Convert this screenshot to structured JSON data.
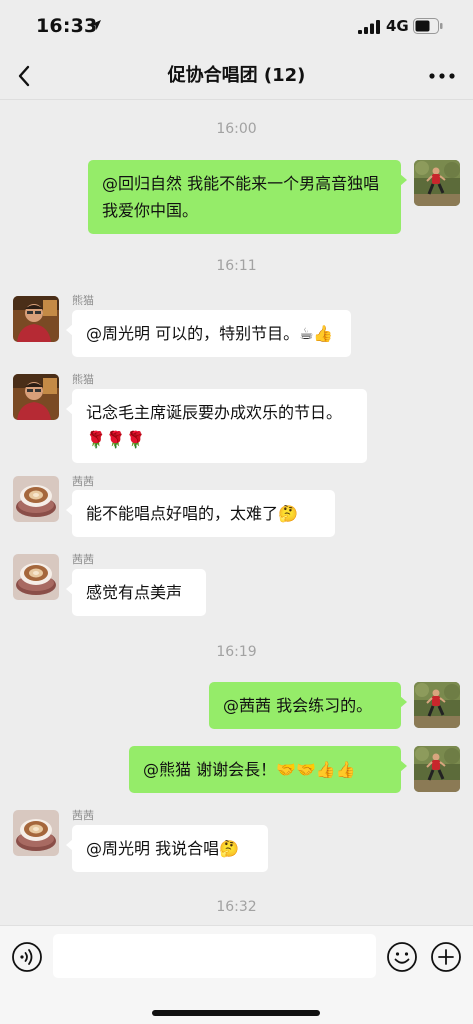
{
  "status_bar": {
    "time": "16:33",
    "network": "4G"
  },
  "header": {
    "title": "促协合唱团 (12)"
  },
  "chat": {
    "timestamps": [
      "16:00",
      "16:11",
      "16:19",
      "16:32"
    ],
    "messages": [
      {
        "side": "out",
        "text": "@回归自然 我能不能来一个男高音独唱  我爱你中国。"
      },
      {
        "side": "in",
        "sender": "熊猫",
        "text": "@周光明 可以的，特别节目。☕👍"
      },
      {
        "side": "in",
        "sender": "熊猫",
        "text": "记念毛主席诞辰要办成欢乐的节日。🌹🌹🌹"
      },
      {
        "side": "in",
        "sender": "茜茜",
        "text": "能不能唱点好唱的，太难了🤔"
      },
      {
        "side": "in",
        "sender": "茜茜",
        "text": "感觉有点美声"
      },
      {
        "side": "out",
        "text": "@茜茜 我会练习的。"
      },
      {
        "side": "out",
        "text": "@熊猫 谢谢会長！🤝🤝👍👍"
      },
      {
        "side": "in",
        "sender": "茜茜",
        "text": "@周光明 我说合唱🤔"
      }
    ]
  },
  "input": {
    "value": ""
  },
  "colors": {
    "background": "#ededed",
    "bubble_out": "#95ec69",
    "bubble_in": "#ffffff",
    "timestamp": "#a2a2a2"
  },
  "icons": {
    "back": "chevron-left-icon",
    "more": "more-icon",
    "voice": "voice-icon",
    "emoji": "emoji-icon",
    "plus": "plus-icon"
  }
}
